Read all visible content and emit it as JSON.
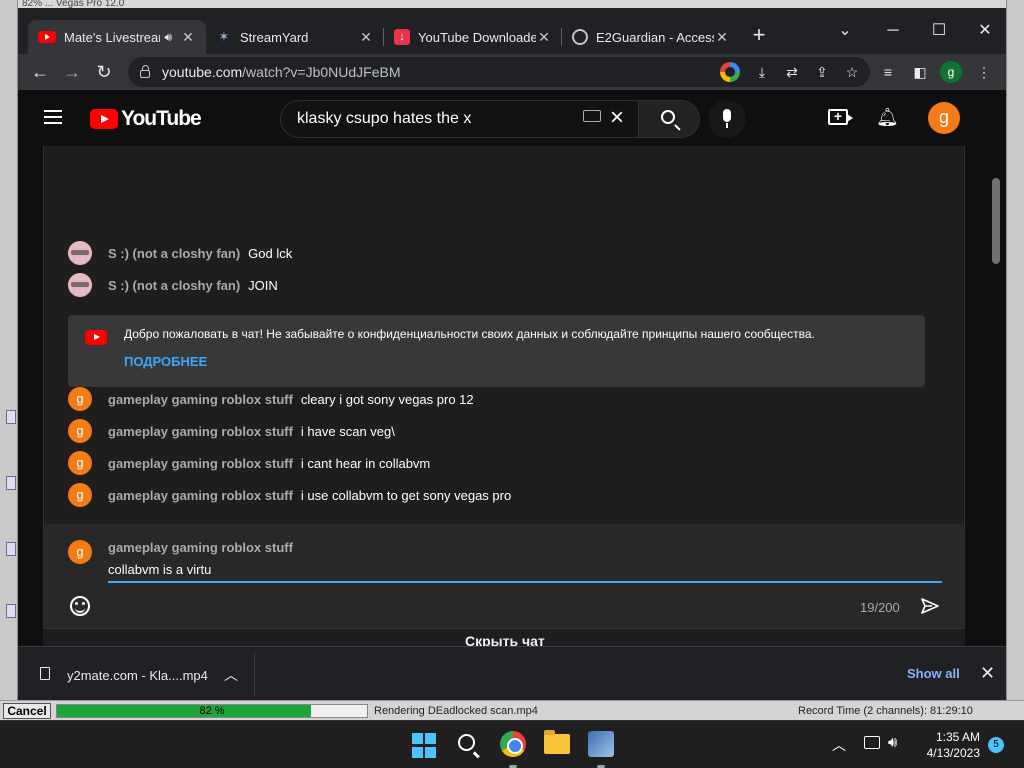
{
  "background_app": {
    "title_fragment": "82% ... Vegas Pro 12.0"
  },
  "browser": {
    "tabs": [
      {
        "title": "Mate's Livestream",
        "icon": "youtube-icon",
        "audio": true,
        "active": true
      },
      {
        "title": "StreamYard",
        "icon": "streamyard-icon",
        "active": false
      },
      {
        "title": "YouTube Downloader",
        "icon": "download-icon",
        "active": false
      },
      {
        "title": "E2Guardian - Access",
        "icon": "globe-icon",
        "active": false
      }
    ],
    "url_host": "youtube.com",
    "url_path": "/watch?v=Jb0NUdJFeBM"
  },
  "youtube": {
    "logo_text": "YouTube",
    "search_value": "klasky csupo hates the x",
    "avatar_letter": "g"
  },
  "chat": {
    "messages_top": [
      {
        "author": "S :) (not a closhy fan)",
        "text": "God lck",
        "avatar": "pink"
      },
      {
        "author": "S :) (not a closhy fan)",
        "text": "JOIN",
        "avatar": "pink"
      }
    ],
    "welcome": {
      "text": "Добро пожаловать в чат! Не забывайте о конфиденциальности своих данных и соблюдайте принципы нашего сообщества.",
      "link": "ПОДРОБНЕЕ"
    },
    "messages_bottom": [
      {
        "author": "gameplay gaming roblox stuff",
        "text": "cleary i got sony vegas pro 12",
        "avatar_letter": "g"
      },
      {
        "author": "gameplay gaming roblox stuff",
        "text": "i have scan veg\\",
        "avatar_letter": "g"
      },
      {
        "author": "gameplay gaming roblox stuff",
        "text": "i cant hear in collabvm",
        "avatar_letter": "g"
      },
      {
        "author": "gameplay gaming roblox stuff",
        "text": "i use collabvm to get sony vegas pro",
        "avatar_letter": "g"
      }
    ],
    "input": {
      "author": "gameplay gaming roblox stuff",
      "avatar_letter": "g",
      "value": "collabvm is a virtu",
      "counter": "19/200"
    },
    "hide_chat_label": "Скрыть чат"
  },
  "download_bar": {
    "file_name": "y2mate.com - Kla....mp4",
    "show_all": "Show all"
  },
  "render": {
    "cancel_label": "Cancel",
    "progress_text": "82 %",
    "progress_fraction": 0.82,
    "status": "Rendering DEadlocked scan.mp4",
    "record_time": "Record Time (2 channels): 81:29:10"
  },
  "taskbar": {
    "time": "1:35 AM",
    "date": "4/13/2023",
    "notification_count": "5"
  },
  "colors": {
    "youtube_red": "#ff0000",
    "avatar_orange": "#f47b16",
    "link_blue": "#3ea6ff",
    "progress_green": "#1ea53a"
  }
}
